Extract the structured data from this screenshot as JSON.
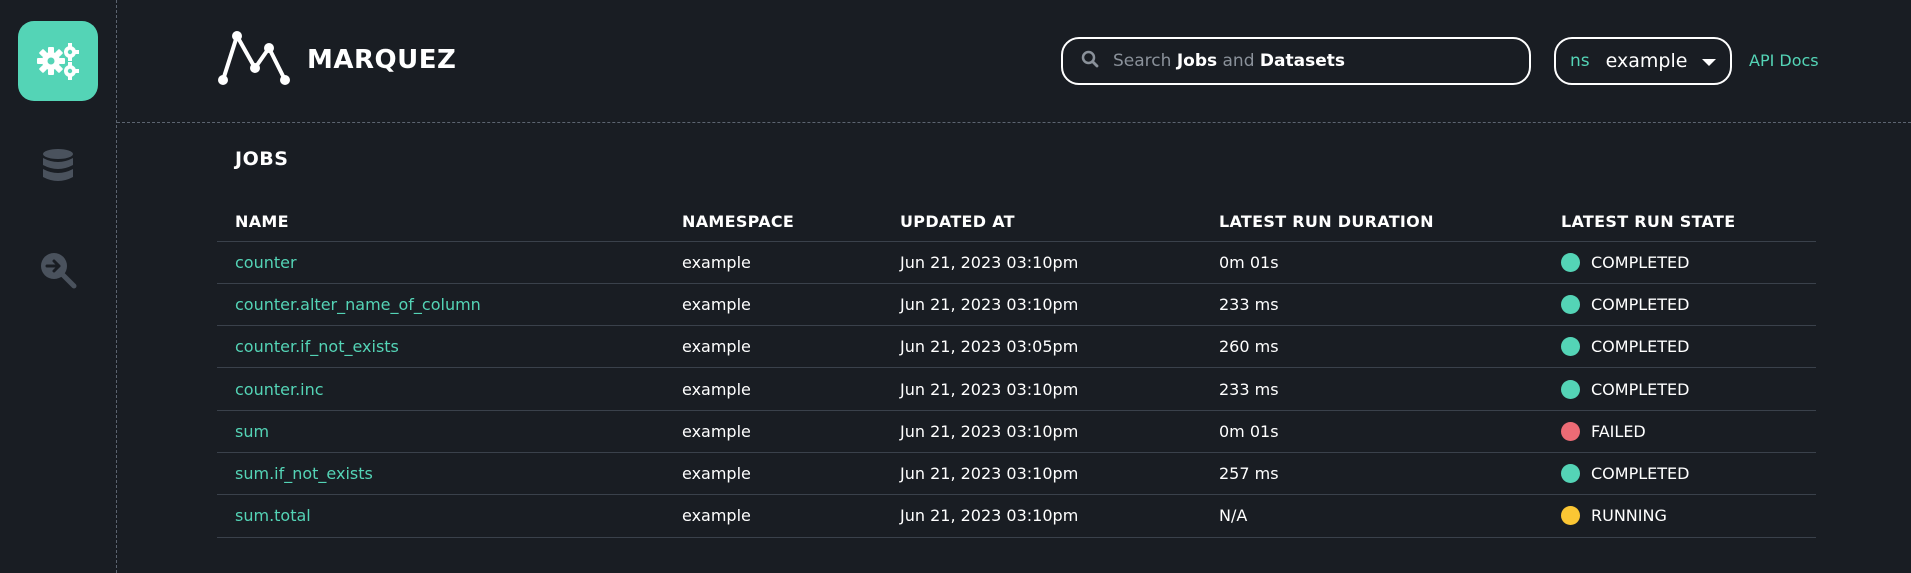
{
  "sidebar": {
    "items": [
      {
        "name": "jobs",
        "icon": "gears-icon",
        "active": true
      },
      {
        "name": "datasets",
        "icon": "database-icon",
        "active": false
      },
      {
        "name": "events",
        "icon": "search-arrow-icon",
        "active": false
      }
    ]
  },
  "header": {
    "logo_text": "MARQUEZ",
    "search": {
      "prefix": "Search",
      "jobs": "Jobs",
      "and": "and",
      "datasets": "Datasets"
    },
    "namespace": {
      "prefix": "ns",
      "value": "example"
    },
    "api_docs": "API Docs"
  },
  "jobs": {
    "title": "JOBS",
    "columns": [
      "NAME",
      "NAMESPACE",
      "UPDATED AT",
      "LATEST RUN DURATION",
      "LATEST RUN STATE"
    ],
    "rows": [
      {
        "name": "counter",
        "namespace": "example",
        "updated_at": "Jun 21, 2023 03:10pm",
        "duration": "0m 01s",
        "state": "COMPLETED",
        "state_color": "#54d4b6"
      },
      {
        "name": "counter.alter_name_of_column",
        "namespace": "example",
        "updated_at": "Jun 21, 2023 03:10pm",
        "duration": "233 ms",
        "state": "COMPLETED",
        "state_color": "#54d4b6"
      },
      {
        "name": "counter.if_not_exists",
        "namespace": "example",
        "updated_at": "Jun 21, 2023 03:05pm",
        "duration": "260 ms",
        "state": "COMPLETED",
        "state_color": "#54d4b6"
      },
      {
        "name": "counter.inc",
        "namespace": "example",
        "updated_at": "Jun 21, 2023 03:10pm",
        "duration": "233 ms",
        "state": "COMPLETED",
        "state_color": "#54d4b6"
      },
      {
        "name": "sum",
        "namespace": "example",
        "updated_at": "Jun 21, 2023 03:10pm",
        "duration": "0m 01s",
        "state": "FAILED",
        "state_color": "#ec6b75"
      },
      {
        "name": "sum.if_not_exists",
        "namespace": "example",
        "updated_at": "Jun 21, 2023 03:10pm",
        "duration": "257 ms",
        "state": "COMPLETED",
        "state_color": "#54d4b6"
      },
      {
        "name": "sum.total",
        "namespace": "example",
        "updated_at": "Jun 21, 2023 03:10pm",
        "duration": "N/A",
        "state": "RUNNING",
        "state_color": "#fbc634"
      }
    ]
  },
  "colors": {
    "background": "#191d23",
    "accent": "#54d4b6",
    "failed": "#ec6b75",
    "running": "#fbc634"
  }
}
